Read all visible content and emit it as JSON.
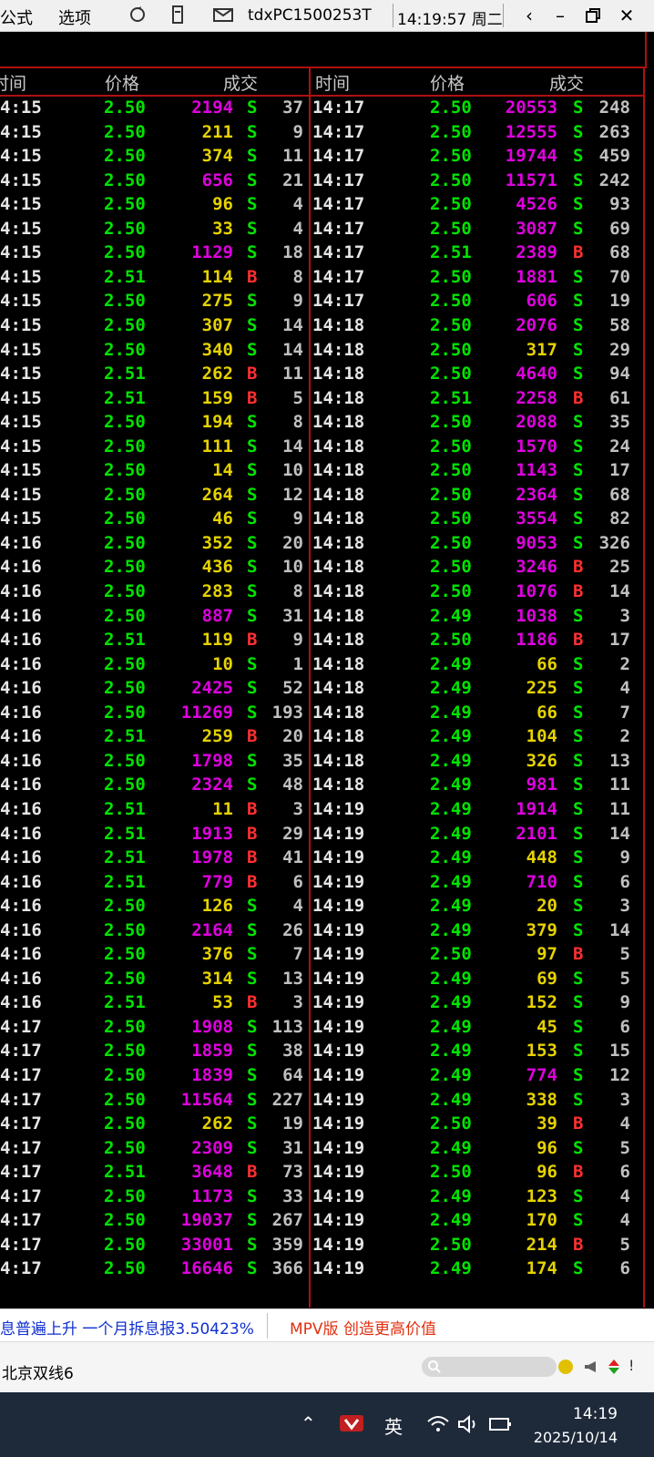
{
  "menu": {
    "formula": "公式",
    "options": "选项",
    "hostname": "tdxPC1500253T",
    "time": "14:19:57 周二"
  },
  "headers": {
    "time": "时间",
    "price": "价格",
    "deal": "成交"
  },
  "left_rows": [
    [
      "4:15",
      "2.50",
      "2194",
      "m",
      "S",
      "37"
    ],
    [
      "4:15",
      "2.50",
      "211",
      "y",
      "S",
      "9"
    ],
    [
      "4:15",
      "2.50",
      "374",
      "y",
      "S",
      "11"
    ],
    [
      "4:15",
      "2.50",
      "656",
      "m",
      "S",
      "21"
    ],
    [
      "4:15",
      "2.50",
      "96",
      "y",
      "S",
      "4"
    ],
    [
      "4:15",
      "2.50",
      "33",
      "y",
      "S",
      "4"
    ],
    [
      "4:15",
      "2.50",
      "1129",
      "m",
      "S",
      "18"
    ],
    [
      "4:15",
      "2.51",
      "114",
      "y",
      "B",
      "8"
    ],
    [
      "4:15",
      "2.50",
      "275",
      "y",
      "S",
      "9"
    ],
    [
      "4:15",
      "2.50",
      "307",
      "y",
      "S",
      "14"
    ],
    [
      "4:15",
      "2.50",
      "340",
      "y",
      "S",
      "14"
    ],
    [
      "4:15",
      "2.51",
      "262",
      "y",
      "B",
      "11"
    ],
    [
      "4:15",
      "2.51",
      "159",
      "y",
      "B",
      "5"
    ],
    [
      "4:15",
      "2.50",
      "194",
      "y",
      "S",
      "8"
    ],
    [
      "4:15",
      "2.50",
      "111",
      "y",
      "S",
      "14"
    ],
    [
      "4:15",
      "2.50",
      "14",
      "y",
      "S",
      "10"
    ],
    [
      "4:15",
      "2.50",
      "264",
      "y",
      "S",
      "12"
    ],
    [
      "4:15",
      "2.50",
      "46",
      "y",
      "S",
      "9"
    ],
    [
      "4:16",
      "2.50",
      "352",
      "y",
      "S",
      "20"
    ],
    [
      "4:16",
      "2.50",
      "436",
      "y",
      "S",
      "10"
    ],
    [
      "4:16",
      "2.50",
      "283",
      "y",
      "S",
      "8"
    ],
    [
      "4:16",
      "2.50",
      "887",
      "m",
      "S",
      "31"
    ],
    [
      "4:16",
      "2.51",
      "119",
      "y",
      "B",
      "9"
    ],
    [
      "4:16",
      "2.50",
      "10",
      "y",
      "S",
      "1"
    ],
    [
      "4:16",
      "2.50",
      "2425",
      "m",
      "S",
      "52"
    ],
    [
      "4:16",
      "2.50",
      "11269",
      "m",
      "S",
      "193"
    ],
    [
      "4:16",
      "2.51",
      "259",
      "y",
      "B",
      "20"
    ],
    [
      "4:16",
      "2.50",
      "1798",
      "m",
      "S",
      "35"
    ],
    [
      "4:16",
      "2.50",
      "2324",
      "m",
      "S",
      "48"
    ],
    [
      "4:16",
      "2.51",
      "11",
      "y",
      "B",
      "3"
    ],
    [
      "4:16",
      "2.51",
      "1913",
      "m",
      "B",
      "29"
    ],
    [
      "4:16",
      "2.51",
      "1978",
      "m",
      "B",
      "41"
    ],
    [
      "4:16",
      "2.51",
      "779",
      "m",
      "B",
      "6"
    ],
    [
      "4:16",
      "2.50",
      "126",
      "y",
      "S",
      "4"
    ],
    [
      "4:16",
      "2.50",
      "2164",
      "m",
      "S",
      "26"
    ],
    [
      "4:16",
      "2.50",
      "376",
      "y",
      "S",
      "7"
    ],
    [
      "4:16",
      "2.50",
      "314",
      "y",
      "S",
      "13"
    ],
    [
      "4:16",
      "2.51",
      "53",
      "y",
      "B",
      "3"
    ],
    [
      "4:17",
      "2.50",
      "1908",
      "m",
      "S",
      "113"
    ],
    [
      "4:17",
      "2.50",
      "1859",
      "m",
      "S",
      "38"
    ],
    [
      "4:17",
      "2.50",
      "1839",
      "m",
      "S",
      "64"
    ],
    [
      "4:17",
      "2.50",
      "11564",
      "m",
      "S",
      "227"
    ],
    [
      "4:17",
      "2.50",
      "262",
      "y",
      "S",
      "19"
    ],
    [
      "4:17",
      "2.50",
      "2309",
      "m",
      "S",
      "31"
    ],
    [
      "4:17",
      "2.51",
      "3648",
      "m",
      "B",
      "73"
    ],
    [
      "4:17",
      "2.50",
      "1173",
      "m",
      "S",
      "33"
    ],
    [
      "4:17",
      "2.50",
      "19037",
      "m",
      "S",
      "267"
    ],
    [
      "4:17",
      "2.50",
      "33001",
      "m",
      "S",
      "359"
    ],
    [
      "4:17",
      "2.50",
      "16646",
      "m",
      "S",
      "366"
    ]
  ],
  "right_rows": [
    [
      "14:17",
      "2.50",
      "20553",
      "m",
      "S",
      "248"
    ],
    [
      "14:17",
      "2.50",
      "12555",
      "m",
      "S",
      "263"
    ],
    [
      "14:17",
      "2.50",
      "19744",
      "m",
      "S",
      "459"
    ],
    [
      "14:17",
      "2.50",
      "11571",
      "m",
      "S",
      "242"
    ],
    [
      "14:17",
      "2.50",
      "4526",
      "m",
      "S",
      "93"
    ],
    [
      "14:17",
      "2.50",
      "3087",
      "m",
      "S",
      "69"
    ],
    [
      "14:17",
      "2.51",
      "2389",
      "m",
      "B",
      "68"
    ],
    [
      "14:17",
      "2.50",
      "1881",
      "m",
      "S",
      "70"
    ],
    [
      "14:17",
      "2.50",
      "606",
      "m",
      "S",
      "19"
    ],
    [
      "14:18",
      "2.50",
      "2076",
      "m",
      "S",
      "58"
    ],
    [
      "14:18",
      "2.50",
      "317",
      "y",
      "S",
      "29"
    ],
    [
      "14:18",
      "2.50",
      "4640",
      "m",
      "S",
      "94"
    ],
    [
      "14:18",
      "2.51",
      "2258",
      "m",
      "B",
      "61"
    ],
    [
      "14:18",
      "2.50",
      "2088",
      "m",
      "S",
      "35"
    ],
    [
      "14:18",
      "2.50",
      "1570",
      "m",
      "S",
      "24"
    ],
    [
      "14:18",
      "2.50",
      "1143",
      "m",
      "S",
      "17"
    ],
    [
      "14:18",
      "2.50",
      "2364",
      "m",
      "S",
      "68"
    ],
    [
      "14:18",
      "2.50",
      "3554",
      "m",
      "S",
      "82"
    ],
    [
      "14:18",
      "2.50",
      "9053",
      "m",
      "S",
      "326"
    ],
    [
      "14:18",
      "2.50",
      "3246",
      "m",
      "B",
      "25"
    ],
    [
      "14:18",
      "2.50",
      "1076",
      "m",
      "B",
      "14"
    ],
    [
      "14:18",
      "2.49",
      "1038",
      "m",
      "S",
      "3"
    ],
    [
      "14:18",
      "2.50",
      "1186",
      "m",
      "B",
      "17"
    ],
    [
      "14:18",
      "2.49",
      "66",
      "y",
      "S",
      "2"
    ],
    [
      "14:18",
      "2.49",
      "225",
      "y",
      "S",
      "4"
    ],
    [
      "14:18",
      "2.49",
      "66",
      "y",
      "S",
      "7"
    ],
    [
      "14:18",
      "2.49",
      "104",
      "y",
      "S",
      "2"
    ],
    [
      "14:18",
      "2.49",
      "326",
      "y",
      "S",
      "13"
    ],
    [
      "14:18",
      "2.49",
      "981",
      "m",
      "S",
      "11"
    ],
    [
      "14:19",
      "2.49",
      "1914",
      "m",
      "S",
      "11"
    ],
    [
      "14:19",
      "2.49",
      "2101",
      "m",
      "S",
      "14"
    ],
    [
      "14:19",
      "2.49",
      "448",
      "y",
      "S",
      "9"
    ],
    [
      "14:19",
      "2.49",
      "710",
      "m",
      "S",
      "6"
    ],
    [
      "14:19",
      "2.49",
      "20",
      "y",
      "S",
      "3"
    ],
    [
      "14:19",
      "2.49",
      "379",
      "y",
      "S",
      "14"
    ],
    [
      "14:19",
      "2.50",
      "97",
      "y",
      "B",
      "5"
    ],
    [
      "14:19",
      "2.49",
      "69",
      "y",
      "S",
      "5"
    ],
    [
      "14:19",
      "2.49",
      "152",
      "y",
      "S",
      "9"
    ],
    [
      "14:19",
      "2.49",
      "45",
      "y",
      "S",
      "6"
    ],
    [
      "14:19",
      "2.49",
      "153",
      "y",
      "S",
      "15"
    ],
    [
      "14:19",
      "2.49",
      "774",
      "m",
      "S",
      "12"
    ],
    [
      "14:19",
      "2.49",
      "338",
      "y",
      "S",
      "3"
    ],
    [
      "14:19",
      "2.50",
      "39",
      "y",
      "B",
      "4"
    ],
    [
      "14:19",
      "2.49",
      "96",
      "y",
      "S",
      "5"
    ],
    [
      "14:19",
      "2.50",
      "96",
      "y",
      "B",
      "6"
    ],
    [
      "14:19",
      "2.49",
      "123",
      "y",
      "S",
      "4"
    ],
    [
      "14:19",
      "2.49",
      "170",
      "y",
      "S",
      "4"
    ],
    [
      "14:19",
      "2.50",
      "214",
      "y",
      "B",
      "5"
    ],
    [
      "14:19",
      "2.49",
      "174",
      "y",
      "S",
      "6"
    ]
  ],
  "ticker": {
    "left_text": "息普遍上升  一个月拆息报3.50423%",
    "right_text": "MPV版   创造更高价值"
  },
  "status": {
    "label": "北京双线6"
  },
  "taskbar": {
    "ime": "英",
    "time": "14:19",
    "date": "2025/10/14"
  },
  "icons": [
    "sync-icon",
    "calculator-icon",
    "mail-icon",
    "back-icon",
    "minimize-icon",
    "restore-icon",
    "close-icon",
    "search-icon",
    "chevron-up-icon",
    "wifi-icon",
    "volume-icon",
    "battery-icon"
  ]
}
